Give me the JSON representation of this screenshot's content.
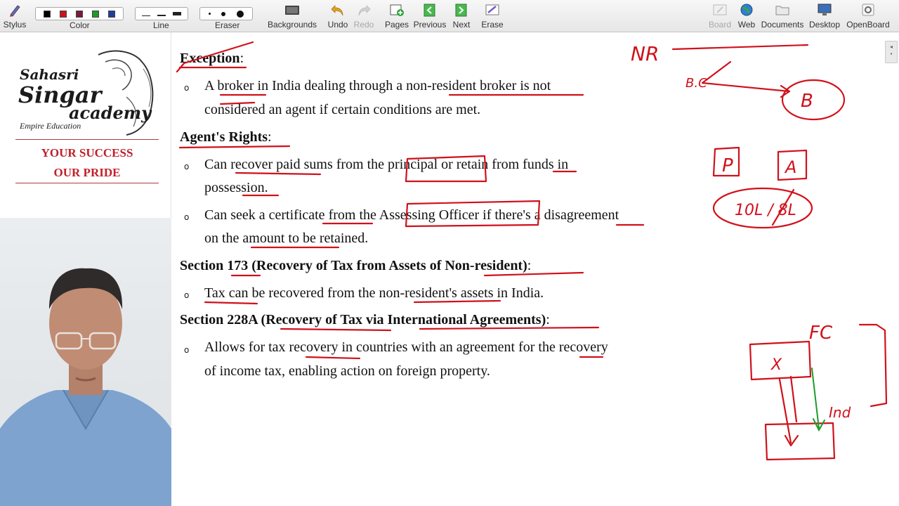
{
  "toolbar": {
    "stylus": "Stylus",
    "color": "Color",
    "line": "Line",
    "eraser": "Eraser",
    "backgrounds": "Backgrounds",
    "undo": "Undo",
    "redo": "Redo",
    "pages": "Pages",
    "previous": "Previous",
    "next": "Next",
    "erase": "Erase",
    "board": "Board",
    "web": "Web",
    "documents": "Documents",
    "desktop": "Desktop",
    "openboard": "OpenBoard",
    "colors": [
      "#000000",
      "#d0111b",
      "#7b1b3a",
      "#1c9c2b",
      "#1d3f9e"
    ]
  },
  "logo": {
    "line1": "Sahasri",
    "line2": "Singar",
    "line3": "academy",
    "tagline": "Empire Education",
    "slogan1": "YOUR SUCCESS",
    "slogan2": "OUR PRIDE"
  },
  "slide": {
    "exception_title": "Exception",
    "exception_b1_l1": "A broker in India dealing through a non-resident broker is not",
    "exception_b1_l2": "considered an agent if certain conditions are met.",
    "rights_title": "Agent's Rights",
    "rights_b1_l1": "Can recover paid sums from the principal or retain from funds in",
    "rights_b1_l2": "possession.",
    "rights_b2_l1": "Can seek a certificate from the Assessing Officer if there's a disagreement",
    "rights_b2_l2": "on the amount to be retained.",
    "s173_title": "Section 173 (Recovery of Tax from Assets of Non-resident)",
    "s173_b1": "Tax can be recovered from the non-resident's assets in India.",
    "s228_title": "Section 228A (Recovery of Tax via International Agreements)",
    "s228_b1_l1": "Allows for tax recovery in countries with an agreement for the recovery",
    "s228_b1_l2": "of income tax, enabling action on foreign property.",
    "colon": ":",
    "bullet": "o"
  },
  "annotations": {
    "nr": "NR",
    "bc": "B.C",
    "b": "B",
    "p": "P",
    "a": "A",
    "ratio": "10L / 8L",
    "fc": "FC",
    "x": "X",
    "ind": "Ind",
    "ink_color": "#d0111b"
  }
}
